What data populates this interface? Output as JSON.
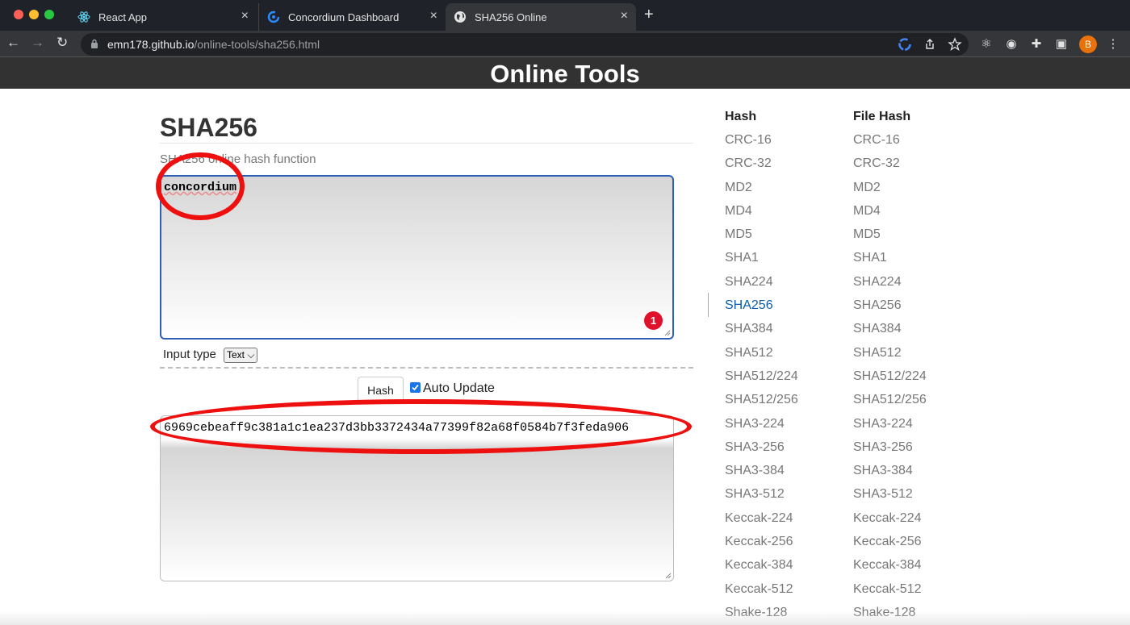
{
  "browser": {
    "tabs": [
      {
        "label": "React App",
        "icon": "react-icon"
      },
      {
        "label": "Concordium Dashboard",
        "icon": "concordium-icon"
      },
      {
        "label": "SHA256 Online",
        "icon": "globe-icon",
        "active": true
      }
    ],
    "url_host": "emn178.github.io",
    "url_path": "/online-tools/sha256.html",
    "avatar_initial": "B"
  },
  "site": {
    "header_title": "Online Tools"
  },
  "main": {
    "title": "SHA256",
    "subtitle": "SHA256 online hash function",
    "input_value": "concordium",
    "error_count": "1",
    "input_type_label": "Input type",
    "input_type_value": "Text",
    "hash_button_label": "Hash",
    "auto_update_label": "Auto Update",
    "auto_update_checked": true,
    "output_value": "6969cebeaff9c381a1c1ea237d3bb3372434a77399f82a68f0584b7f3feda906"
  },
  "sidebar": {
    "hash_heading": "Hash",
    "file_hash_heading": "File Hash",
    "hash_items": [
      "CRC-16",
      "CRC-32",
      "MD2",
      "MD4",
      "MD5",
      "SHA1",
      "SHA224",
      "SHA256",
      "SHA384",
      "SHA512",
      "SHA512/224",
      "SHA512/256",
      "SHA3-224",
      "SHA3-256",
      "SHA3-384",
      "SHA3-512",
      "Keccak-224",
      "Keccak-256",
      "Keccak-384",
      "Keccak-512",
      "Shake-128"
    ],
    "file_hash_items": [
      "CRC-16",
      "CRC-32",
      "MD2",
      "MD4",
      "MD5",
      "SHA1",
      "SHA224",
      "SHA256",
      "SHA384",
      "SHA512",
      "SHA512/224",
      "SHA512/256",
      "SHA3-224",
      "SHA3-256",
      "SHA3-384",
      "SHA3-512",
      "Keccak-224",
      "Keccak-256",
      "Keccak-384",
      "Keccak-512",
      "Shake-128"
    ],
    "active_item": "SHA256"
  },
  "colors": {
    "annotation": "#ee0f0f",
    "active_link": "#0b5cad",
    "header_bg": "#323232"
  }
}
